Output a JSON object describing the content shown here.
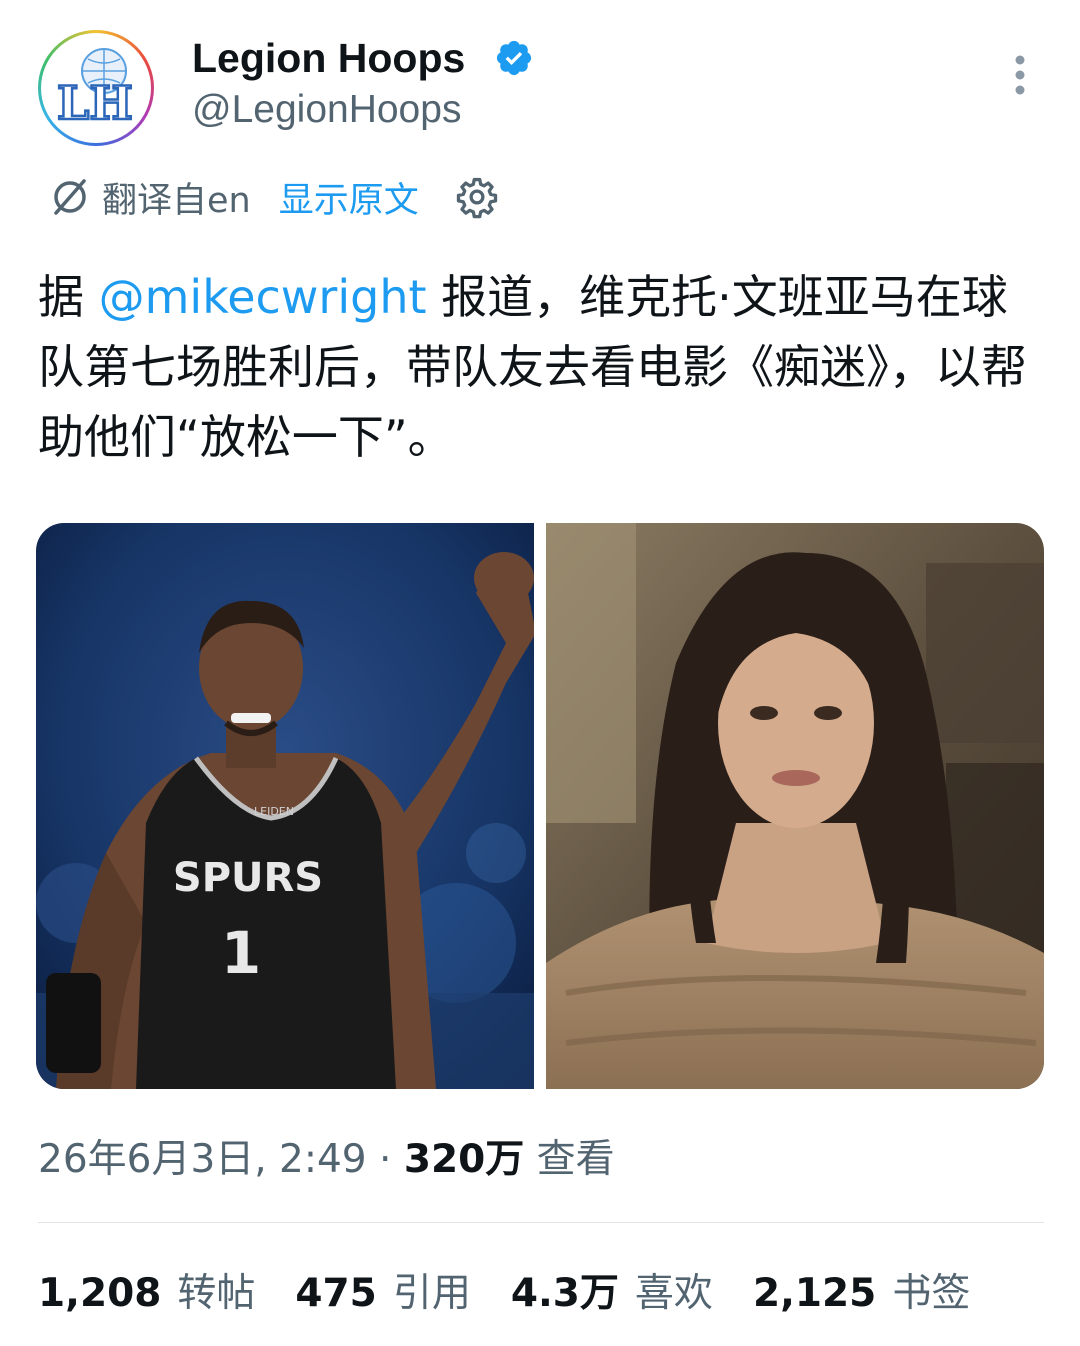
{
  "author": {
    "display_name": "Legion Hoops",
    "handle": "@LegionHoops",
    "avatar_text": "LH"
  },
  "translation": {
    "from_label": "翻译自en",
    "show_original_label": "显示原文"
  },
  "tweet": {
    "prefix": "据 ",
    "mention": "@mikecwright",
    "body": " 报道，维克托·文班亚马在球队第七场胜利后，带队友去看电影《痴迷》，以帮助他们“放松一下”。"
  },
  "media": {
    "photo1": {
      "jersey_team": "SPURS",
      "jersey_number": "1",
      "jersey_patch": "LEIDEN"
    }
  },
  "meta": {
    "timestamp": "26年6月3日, 2:49",
    "separator": " · ",
    "views_count": "320万",
    "views_label": " 查看"
  },
  "stats": {
    "reposts": {
      "count": "1,208",
      "label": "转帖"
    },
    "quotes": {
      "count": "475",
      "label": "引用"
    },
    "likes": {
      "count": "4.3万",
      "label": "喜欢"
    },
    "bookmarks": {
      "count": "2,125",
      "label": "书签"
    }
  },
  "colors": {
    "accent": "#1d9bf0",
    "text": "#0f1419",
    "secondary": "#536471"
  }
}
